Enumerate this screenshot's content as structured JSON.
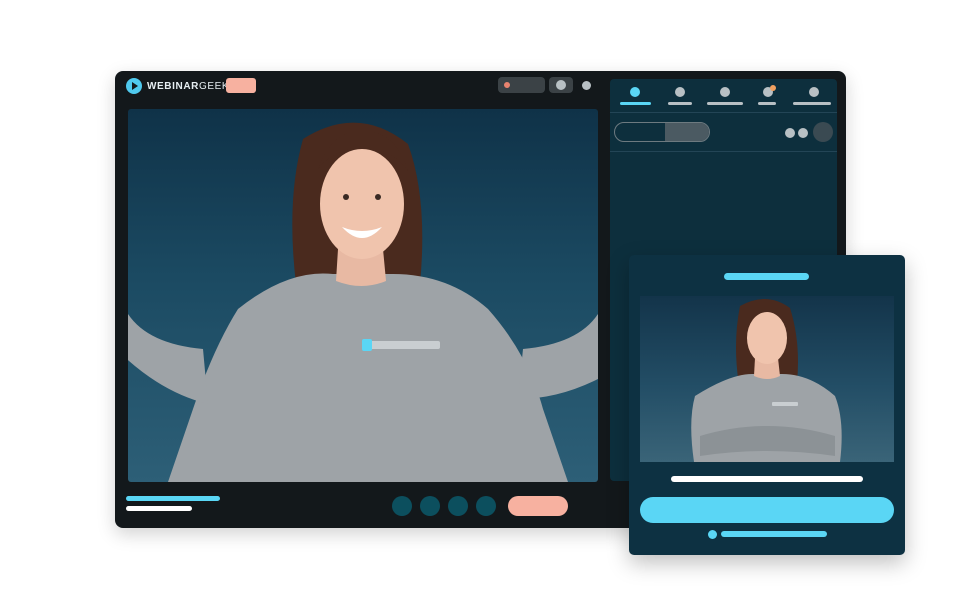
{
  "app": {
    "brand": {
      "name_bold": "WEBINAR",
      "name_light": "GEEK"
    },
    "colors": {
      "accent": "#5ad6f5",
      "live": "#f7b1a0",
      "window": "#13181b",
      "panel": "#0d2f3d",
      "control": "#0c4f5e"
    },
    "icons": {
      "logo": "play-logo-icon",
      "record": "record-dot-icon",
      "camera": "camera-dot-icon",
      "more": "more-dot-icon"
    },
    "side_panel": {
      "tabs": [
        {
          "name": "tab-1",
          "active": true
        },
        {
          "name": "tab-2",
          "active": false
        },
        {
          "name": "tab-3",
          "active": false
        },
        {
          "name": "tab-4",
          "active": false,
          "notification": true
        },
        {
          "name": "tab-5",
          "active": false
        }
      ]
    }
  },
  "registration_card": {
    "colors": {
      "background": "#0d3142",
      "cta": "#5ad6f5"
    }
  }
}
